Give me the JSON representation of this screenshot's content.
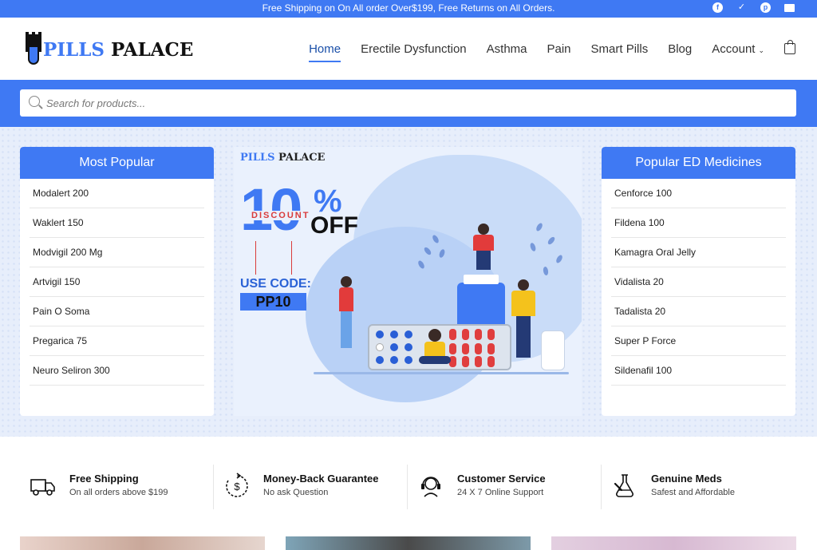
{
  "topbar": {
    "message": "Free Shipping on On All order Over$199, Free Returns on All Orders.",
    "social": [
      {
        "icon": "facebook-icon",
        "glyph": "f"
      },
      {
        "icon": "twitter-icon",
        "glyph": "✓"
      },
      {
        "icon": "pinterest-icon",
        "glyph": "p"
      },
      {
        "icon": "mail-icon",
        "glyph": ""
      }
    ]
  },
  "brand": {
    "part1": "PILLS",
    "part2": " PALACE"
  },
  "nav": {
    "items": [
      "Home",
      "Erectile Dysfunction",
      "Asthma",
      "Pain",
      "Smart Pills",
      "Blog",
      "Account"
    ],
    "active": "Home",
    "account_chevron": "⌄"
  },
  "search": {
    "placeholder": "Search for products..."
  },
  "most_popular": {
    "title": "Most Popular",
    "items": [
      "Modalert 200",
      "Waklert 150",
      "Modvigil 200 Mg",
      "Artvigil 150",
      "Pain O Soma",
      "Pregarica 75",
      "Neuro Seliron 300"
    ]
  },
  "popular_ed": {
    "title": "Popular ED Medicines",
    "items": [
      "Cenforce 100",
      "Fildena 100",
      "Kamagra Oral Jelly",
      "Vidalista 20",
      "Tadalista 20",
      "Super P Force",
      "Sildenafil 100"
    ]
  },
  "banner": {
    "brand_part1": "PILLS",
    "brand_part2": " PALACE",
    "big_number": "10",
    "percent": "%",
    "discount_label": "DISCOUNT",
    "off_label": "OFF",
    "use_code_label": "USE CODE:",
    "code": "PP10"
  },
  "features": [
    {
      "icon": "truck-icon",
      "title": "Free Shipping",
      "subtitle": "On all orders above $199"
    },
    {
      "icon": "money-back-icon",
      "title": "Money-Back Guarantee",
      "subtitle": "No ask Question"
    },
    {
      "icon": "headset-icon",
      "title": "Customer Service",
      "subtitle": "24 X 7 Online Support"
    },
    {
      "icon": "lab-flask-icon",
      "title": "Genuine Meds",
      "subtitle": "Safest and Affordable"
    }
  ],
  "colors": {
    "accent": "#3f79f3",
    "discount_red": "#d93b3b",
    "hero_bg": "#e7eefb"
  }
}
